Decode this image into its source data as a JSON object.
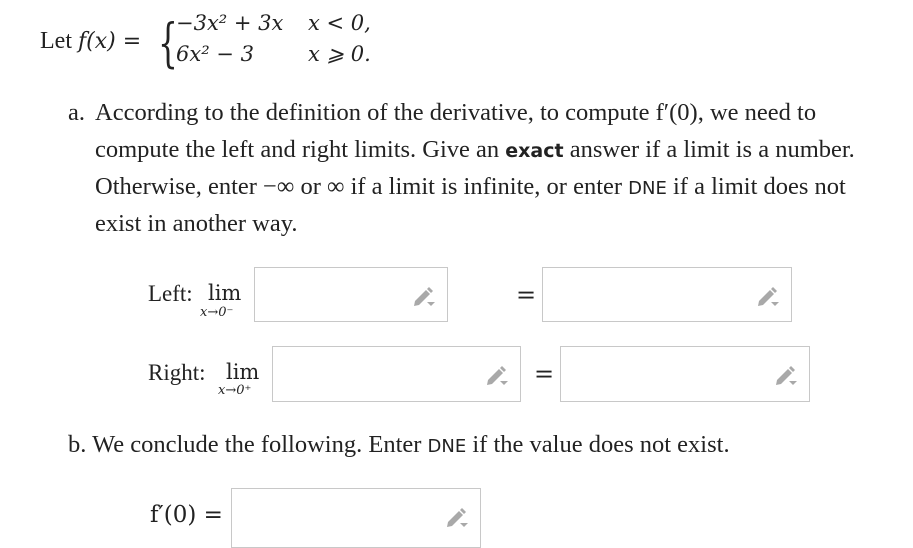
{
  "function_def": {
    "prefix": "Let",
    "fname": "f(x) =",
    "cases": [
      {
        "expr": "−3x² + 3x",
        "condition": "x < 0,"
      },
      {
        "expr": "6x² − 3",
        "condition": "x ⩾ 0."
      }
    ]
  },
  "part_a": {
    "label": "a.",
    "lines": [
      "According to the definition of the derivative, to compute f′(0), we need to",
      "compute the left and right limits. Give an",
      "answer if a limit is a number.",
      "Otherwise, enter −∞ or ∞ if a limit is infinite, or enter",
      "if a limit does not",
      "exist in another way."
    ],
    "bold_word": "exact",
    "dne_word": "DNE",
    "left": {
      "label": "Left:",
      "lim": "lim",
      "subscript": "x→0⁻",
      "equals": "=",
      "input1_value": "",
      "input2_value": ""
    },
    "right": {
      "label": "Right:",
      "lim": "lim",
      "subscript": "x→0⁺",
      "equals": "=",
      "input1_value": "",
      "input2_value": ""
    }
  },
  "part_b": {
    "label": "b.",
    "text_before": "We conclude the following. Enter",
    "dne_word": "DNE",
    "text_after": "if the value does not exist.",
    "answer_label": "f′(0) =",
    "input_value": ""
  },
  "icons": {
    "input_tool": "pencil-dropdown-icon"
  },
  "colors": {
    "text": "#222222",
    "box_border": "#c8c8c8",
    "icon": "#a9a9a9"
  }
}
